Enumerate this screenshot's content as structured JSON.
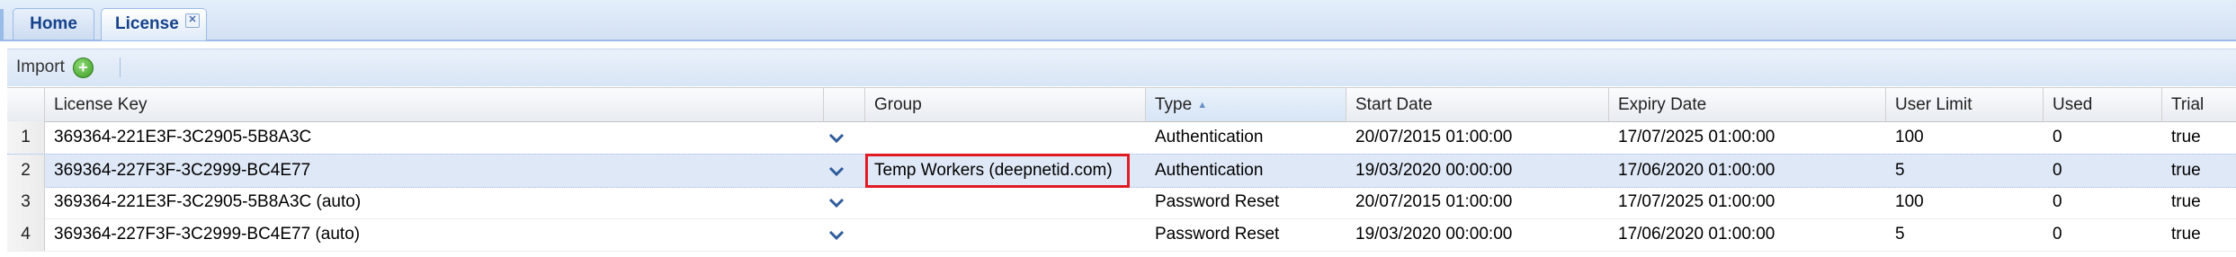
{
  "tabs": [
    {
      "label": "Home"
    },
    {
      "label": "License"
    }
  ],
  "toolbar": {
    "import_label": "Import"
  },
  "grid": {
    "columns": {
      "license_key": "License Key",
      "group": "Group",
      "type": "Type",
      "start_date": "Start Date",
      "expiry_date": "Expiry Date",
      "user_limit": "User Limit",
      "used": "Used",
      "trial": "Trial"
    },
    "sort": {
      "column": "Type",
      "direction": "ascending"
    },
    "rows": [
      {
        "num": "1",
        "license_key": "369364-221E3F-3C2905-5B8A3C",
        "group": "",
        "type": "Authentication",
        "start_date": "20/07/2015 01:00:00",
        "expiry_date": "17/07/2025 01:00:00",
        "user_limit": "100",
        "used": "0",
        "trial": "true"
      },
      {
        "num": "2",
        "license_key": "369364-227F3F-3C2999-BC4E77",
        "group": "Temp Workers (deepnetid.com)",
        "type": "Authentication",
        "start_date": "19/03/2020 00:00:00",
        "expiry_date": "17/06/2020 01:00:00",
        "user_limit": "5",
        "used": "0",
        "trial": "true"
      },
      {
        "num": "3",
        "license_key": "369364-221E3F-3C2905-5B8A3C (auto)",
        "group": "",
        "type": "Password Reset",
        "start_date": "20/07/2015 01:00:00",
        "expiry_date": "17/07/2025 01:00:00",
        "user_limit": "100",
        "used": "0",
        "trial": "true"
      },
      {
        "num": "4",
        "license_key": "369364-227F3F-3C2999-BC4E77 (auto)",
        "group": "",
        "type": "Password Reset",
        "start_date": "19/03/2020 00:00:00",
        "expiry_date": "17/06/2020 01:00:00",
        "user_limit": "5",
        "used": "0",
        "trial": "true"
      }
    ]
  },
  "selected_row": "2",
  "colors": {
    "accent": "#15428b",
    "highlight": "#e01b24",
    "selection": "#dfe8f6"
  }
}
